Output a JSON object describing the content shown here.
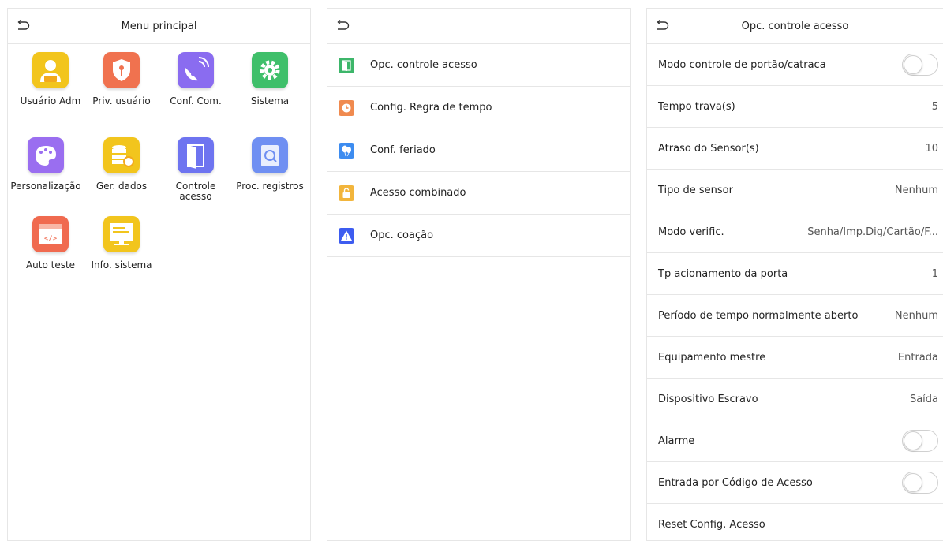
{
  "panel_main": {
    "title": "Menu principal",
    "tiles": [
      {
        "label": "Usuário Adm",
        "icon": "user-admin-icon",
        "color": "#f2c51d"
      },
      {
        "label": "Priv. usuário",
        "icon": "user-privilege-icon",
        "color": "#f0724f"
      },
      {
        "label": "Conf. Com.",
        "icon": "communication-icon",
        "color": "#8a6cf0"
      },
      {
        "label": "Sistema",
        "icon": "system-gear-icon",
        "color": "#3fbf6a"
      },
      {
        "label": "Personalização",
        "icon": "personalize-palette-icon",
        "color": "#9a6ef0"
      },
      {
        "label": "Ger. dados",
        "icon": "data-management-icon",
        "color": "#f2c51d"
      },
      {
        "label": "Controle\nacesso",
        "icon": "access-control-door-icon",
        "color": "#6e74f0"
      },
      {
        "label": "Proc. registros",
        "icon": "attendance-search-icon",
        "color": "#6f8ff2"
      },
      {
        "label": "Auto teste",
        "icon": "autotest-code-icon",
        "color": "#f06a4f"
      },
      {
        "label": "Info. sistema",
        "icon": "system-info-monitor-icon",
        "color": "#f2c51d"
      }
    ]
  },
  "panel_access": {
    "items": [
      {
        "label": "Opc. controle acesso",
        "icon": "door-icon",
        "color": "#3db66a"
      },
      {
        "label": "Config. Regra de tempo",
        "icon": "clock-icon",
        "color": "#f08a4f"
      },
      {
        "label": "Conf. feriado",
        "icon": "balloons-icon",
        "color": "#3d8cf0"
      },
      {
        "label": "Acesso combinado",
        "icon": "unlock-icon",
        "color": "#f2b53c"
      },
      {
        "label": "Opc. coação",
        "icon": "warning-icon",
        "color": "#3d5cf0"
      }
    ]
  },
  "panel_options": {
    "title": "Opc. controle acesso",
    "rows": [
      {
        "label": "Modo controle de portão/catraca",
        "type": "toggle",
        "on": false
      },
      {
        "label": "Tempo trava(s)",
        "type": "value",
        "value": "5"
      },
      {
        "label": "Atraso do Sensor(s)",
        "type": "value",
        "value": "10"
      },
      {
        "label": "Tipo de sensor",
        "type": "value",
        "value": "Nenhum"
      },
      {
        "label": "Modo verific.",
        "type": "value",
        "value": "Senha/Imp.Dig/Cartão/F..."
      },
      {
        "label": "Tp acionamento da porta",
        "type": "value",
        "value": "1"
      },
      {
        "label": "Período de tempo normalmente aberto",
        "type": "value",
        "value": "Nenhum"
      },
      {
        "label": "Equipamento mestre",
        "type": "value",
        "value": "Entrada"
      },
      {
        "label": "Dispositivo Escravo",
        "type": "value",
        "value": "Saída"
      },
      {
        "label": "Alarme",
        "type": "toggle",
        "on": false
      },
      {
        "label": "Entrada por Código de Acesso",
        "type": "toggle",
        "on": false
      },
      {
        "label": "Reset Config. Acesso",
        "type": "none"
      }
    ]
  }
}
